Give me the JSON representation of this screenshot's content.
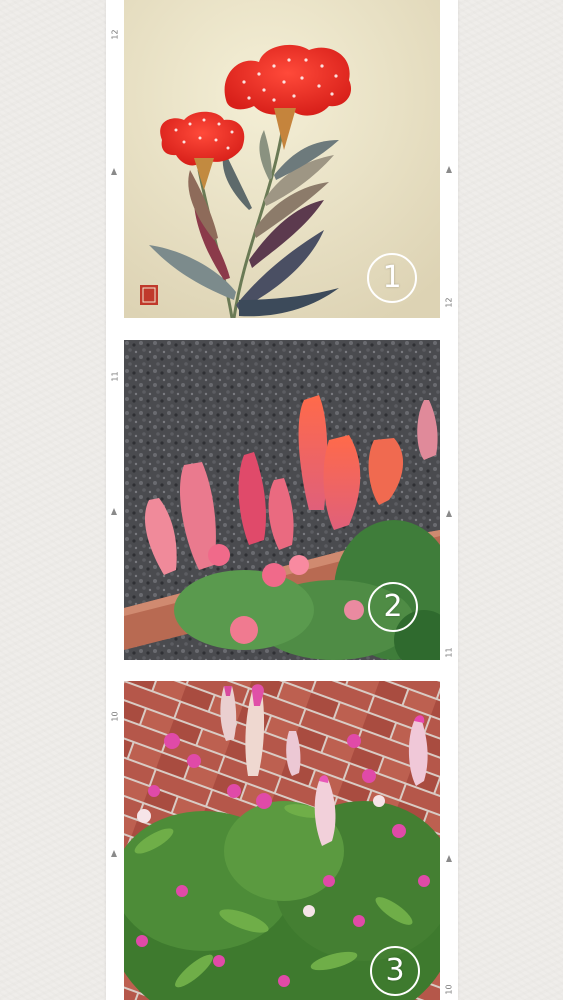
{
  "strip": {
    "frames": [
      {
        "label": "1",
        "frame_numbers": [
          "12",
          "12"
        ]
      },
      {
        "label": "2",
        "frame_numbers": [
          "11",
          "11"
        ]
      },
      {
        "label": "3",
        "frame_numbers": [
          "10",
          "10"
        ]
      }
    ]
  }
}
